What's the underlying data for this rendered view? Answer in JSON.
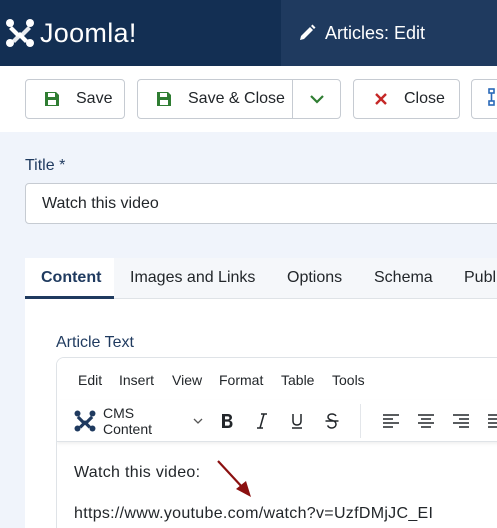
{
  "brand": {
    "name": "Joomla!",
    "logo_icon": "joomla-logo-icon"
  },
  "header": {
    "title": "Articles: Edit",
    "icon": "pencil-icon"
  },
  "toolbar": {
    "save_label": "Save",
    "save_close_label": "Save & Close",
    "close_label": "Close",
    "accent_green": "#2f7d32",
    "accent_red": "#c52827"
  },
  "form": {
    "title_label": "Title *",
    "title_value": "Watch this video"
  },
  "tabs": [
    {
      "label": "Content",
      "active": true
    },
    {
      "label": "Images and Links"
    },
    {
      "label": "Options"
    },
    {
      "label": "Schema"
    },
    {
      "label": "Publ"
    }
  ],
  "editor": {
    "label": "Article Text",
    "menu": [
      "Edit",
      "Insert",
      "View",
      "Format",
      "Table",
      "Tools"
    ],
    "format_dropdown": "CMS Content",
    "buttons": [
      "bold-icon",
      "italic-icon",
      "underline-icon",
      "strikethrough-icon",
      "align-left-icon",
      "align-center-icon",
      "align-right-icon",
      "align-justify-icon"
    ],
    "content_lines": [
      "Watch this video:",
      "https://www.youtube.com/watch?v=UzfDMjJC_EI"
    ],
    "annotation_color": "#8b1010"
  }
}
